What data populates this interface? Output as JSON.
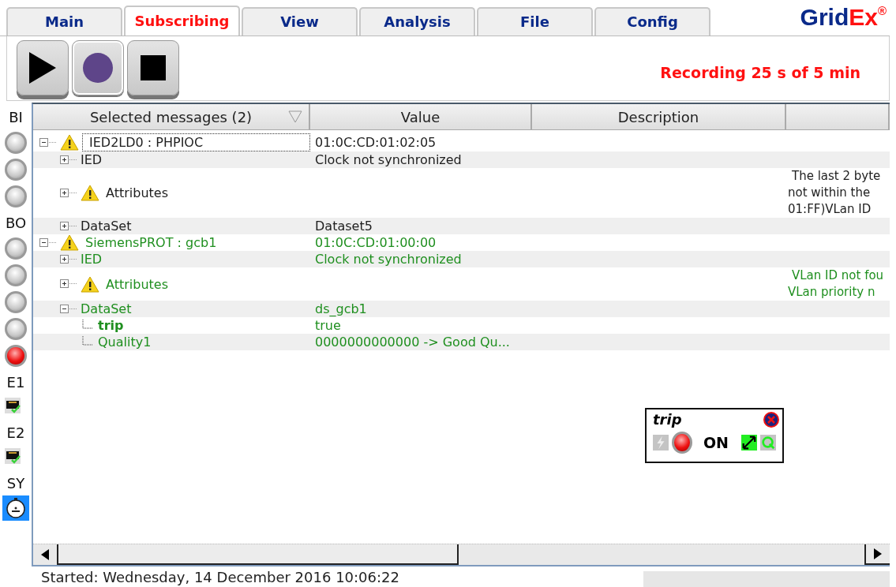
{
  "tabs": [
    {
      "label": "Main",
      "selected": false
    },
    {
      "label": "Subscribing",
      "selected": true
    },
    {
      "label": "View",
      "selected": false
    },
    {
      "label": "Analysis",
      "selected": false
    },
    {
      "label": "File",
      "selected": false
    },
    {
      "label": "Config",
      "selected": false
    }
  ],
  "logo": {
    "primary": "Grid",
    "accent": "Ex",
    "mark": "®"
  },
  "toolbar": {
    "buttons": [
      {
        "kind": "play",
        "pressed": false
      },
      {
        "kind": "record",
        "pressed": true
      },
      {
        "kind": "stop",
        "pressed": false
      }
    ],
    "status": "Recording 25 s of 5 min"
  },
  "sidebar": [
    {
      "kind": "label",
      "text": "BI"
    },
    {
      "kind": "led",
      "on": false
    },
    {
      "kind": "led",
      "on": false
    },
    {
      "kind": "led",
      "on": false
    },
    {
      "kind": "label",
      "text": "BO"
    },
    {
      "kind": "led",
      "on": false
    },
    {
      "kind": "led",
      "on": false
    },
    {
      "kind": "led",
      "on": false
    },
    {
      "kind": "led",
      "on": false
    },
    {
      "kind": "led",
      "on": true
    },
    {
      "kind": "label",
      "text": "E1"
    },
    {
      "kind": "network"
    },
    {
      "kind": "label",
      "text": "E2"
    },
    {
      "kind": "network"
    },
    {
      "kind": "label",
      "text": "SY"
    },
    {
      "kind": "clock",
      "selected": true
    }
  ],
  "table": {
    "columns": [
      "Selected messages (2)",
      "Value",
      "Description"
    ],
    "messages": [
      {
        "label": "IED2LD0 : PHPIOC",
        "value": "01:0C:CD:01:02:05",
        "warning": true,
        "expanded": true,
        "focused": true,
        "color": "#1e1e1e",
        "children": [
          {
            "label": "IED",
            "value": "Clock not synchronized",
            "warning": false,
            "expanded": false
          },
          {
            "label": "Attributes",
            "warning": true,
            "expanded": false,
            "column_4": [
              "The last 2 byte",
              "not within the",
              "01:FF)VLan ID"
            ]
          },
          {
            "label": "DataSet",
            "value": "Dataset5",
            "warning": false,
            "expanded": false
          }
        ]
      },
      {
        "label": "SiemensPROT : gcb1",
        "value": "01:0C:CD:01:00:00",
        "warning": true,
        "expanded": true,
        "focused": false,
        "color": "#1f8f1f",
        "children": [
          {
            "label": "IED",
            "value": "Clock not synchronized",
            "warning": false,
            "expanded": false
          },
          {
            "label": "Attributes",
            "warning": true,
            "expanded": false,
            "column_4": [
              "VLan ID not fou",
              "VLan priority n"
            ]
          },
          {
            "label": "DataSet",
            "value": "ds_gcb1",
            "warning": false,
            "expanded": true,
            "children": [
              {
                "label": "trip",
                "value": "true",
                "bold": true
              },
              {
                "label": "Quality1",
                "value": "0000000000000 -> Good Qu...",
                "bold": false
              }
            ]
          }
        ]
      }
    ]
  },
  "popup": {
    "title": "trip",
    "state": "ON",
    "on": true
  },
  "status_bar": "Started: Wednesday, 14 December 2016 10:06:22"
}
